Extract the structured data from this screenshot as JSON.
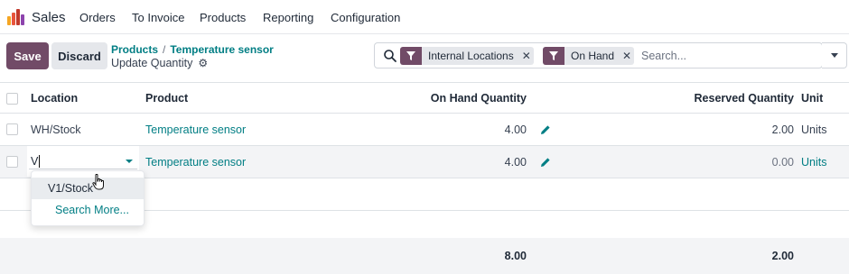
{
  "topnav": {
    "app_name": "Sales",
    "menu": [
      "Orders",
      "To Invoice",
      "Products",
      "Reporting",
      "Configuration"
    ],
    "logo_colors": [
      "#f5a623",
      "#e8553d",
      "#c0392b",
      "#8e44ad"
    ]
  },
  "toolbar": {
    "save_label": "Save",
    "discard_label": "Discard"
  },
  "breadcrumb": {
    "parent": "Products",
    "separator": "/",
    "current": "Temperature sensor",
    "subtitle": "Update Quantity"
  },
  "search": {
    "facets": [
      {
        "label": "Internal Locations",
        "icon": "filter-icon"
      },
      {
        "label": "On Hand",
        "icon": "filter-icon"
      }
    ],
    "placeholder": "Search..."
  },
  "table": {
    "headers": {
      "location": "Location",
      "product": "Product",
      "on_hand": "On Hand Quantity",
      "reserved": "Reserved Quantity",
      "unit": "Unit"
    },
    "rows": [
      {
        "location": "WH/Stock",
        "product": "Temperature sensor",
        "on_hand": "4.00",
        "reserved": "2.00",
        "unit": "Units"
      },
      {
        "location": "V",
        "product": "Temperature sensor",
        "on_hand": "4.00",
        "reserved": "0.00",
        "unit": "Units"
      }
    ],
    "totals": {
      "on_hand": "8.00",
      "reserved": "2.00"
    }
  },
  "location_dropdown": {
    "options": [
      "V1/Stock"
    ],
    "search_more": "Search More..."
  },
  "colors": {
    "primary": "#714b67",
    "link": "#017e84"
  }
}
